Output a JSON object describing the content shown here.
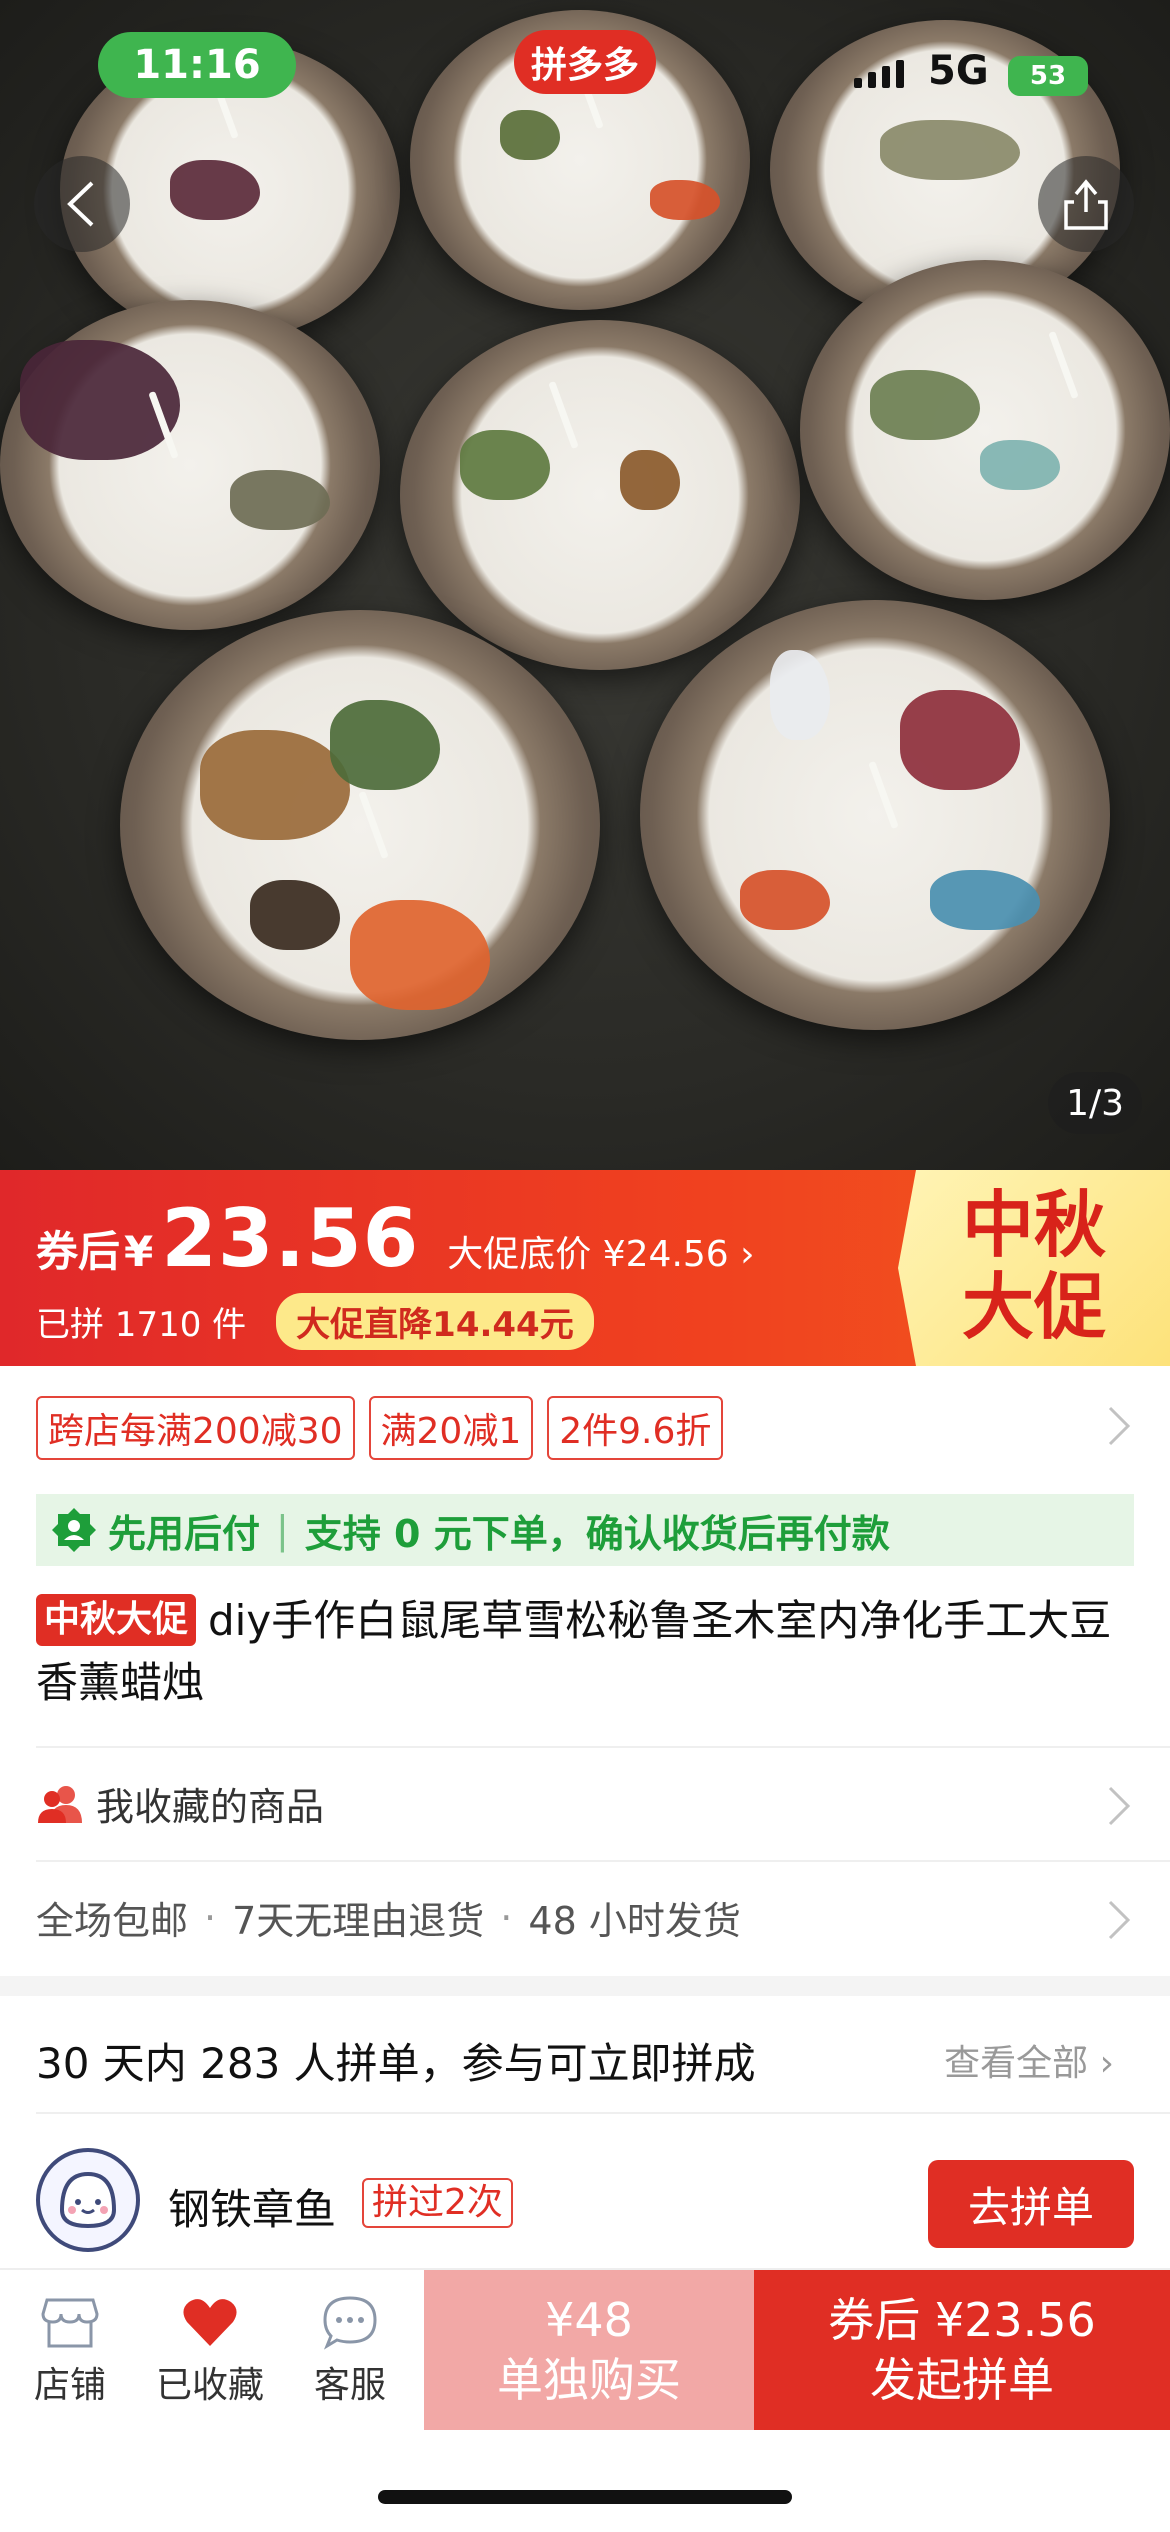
{
  "status_bar": {
    "time": "11:16",
    "app_badge": "拼多多",
    "network": "5G",
    "battery": "53"
  },
  "hero": {
    "page_indicator": "1/3"
  },
  "price": {
    "coupon_label": "券后",
    "currency": "¥",
    "amount": "23.56",
    "promo_floor": "大促底价 ¥24.56 ›",
    "sold": "已拼 1710 件",
    "drop_tag": "大促直降14.44元",
    "festival_line1": "中秋",
    "festival_line2": "大促"
  },
  "coupons": [
    "跨店每满200减30",
    "满20减1",
    "2件9.6折"
  ],
  "pay_later": {
    "title": "先用后付",
    "desc": "支持 0 元下单，确认收货后再付款"
  },
  "product": {
    "tag": "中秋大促",
    "title": "diy手作白鼠尾草雪松秘鲁圣木室内净化手工大豆香薰蜡烛"
  },
  "favorites_row": {
    "label": "我收藏的商品"
  },
  "service_row": {
    "items": [
      "全场包邮",
      "7天无理由退货",
      "48 小时发货"
    ]
  },
  "group_buy": {
    "title": "30 天内 283 人拼单，参与可立即拼成",
    "view_all": "查看全部 ›",
    "user": {
      "name": "钢铁章鱼",
      "badge": "拼过2次",
      "button": "去拼单"
    }
  },
  "bottom_bar": {
    "tabs": [
      {
        "label": "店铺",
        "icon": "store-icon"
      },
      {
        "label": "已收藏",
        "icon": "heart-icon"
      },
      {
        "label": "客服",
        "icon": "chat-icon"
      }
    ],
    "solo_price": "¥48",
    "solo_label": "单独购买",
    "group_price": "券后 ¥23.56",
    "group_label": "发起拼单"
  },
  "colors": {
    "accent": "#e02e24",
    "green": "#1e9e3a",
    "festival_bg": "#fde27a"
  }
}
